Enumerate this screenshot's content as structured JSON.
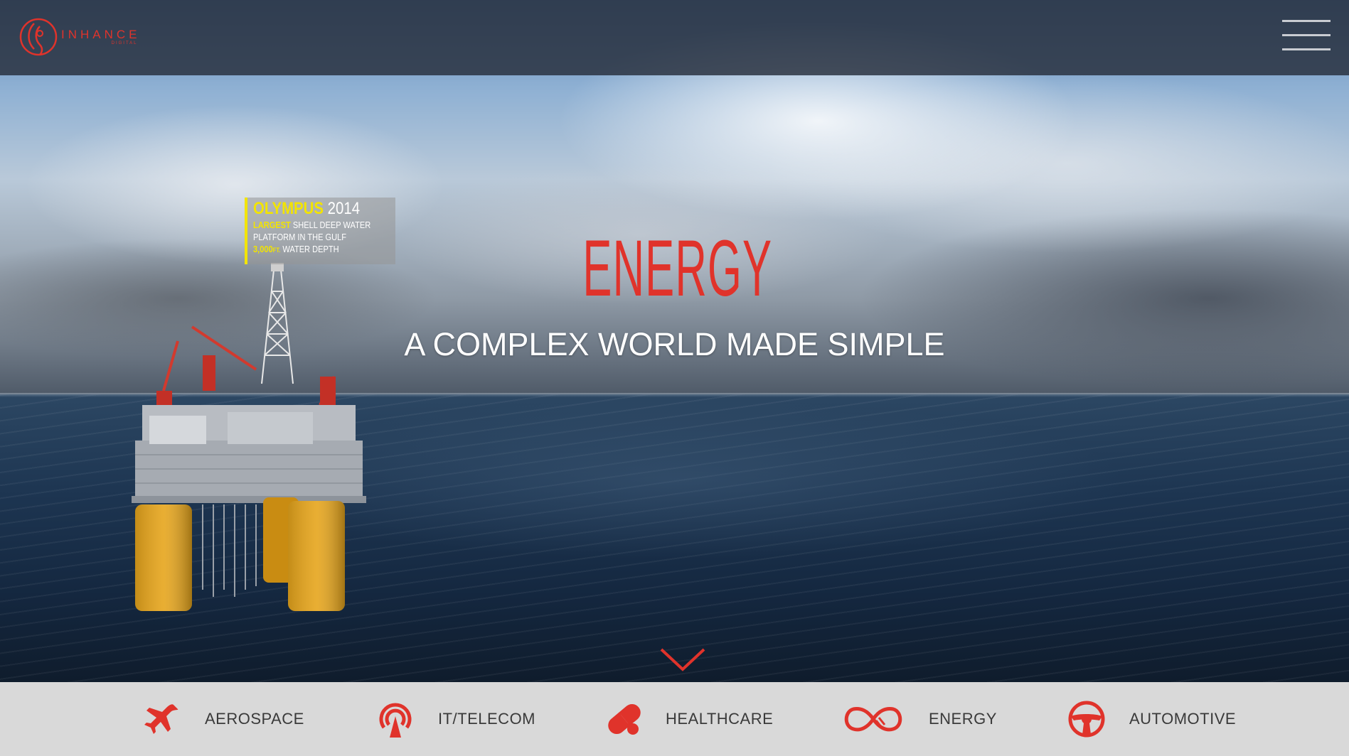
{
  "header": {
    "logo_name": "INHANCE",
    "logo_sub": "DIGITAL",
    "menu_icon": "hamburger-menu-icon"
  },
  "hero": {
    "title": "ENERGY",
    "subtitle": "A COMPLEX WORLD MADE SIMPLE",
    "scroll_icon": "chevron-down-icon"
  },
  "callout": {
    "name": "OLYMPUS",
    "year": "2014",
    "line2_highlight": "LARGEST",
    "line2_rest": "SHELL DEEP WATER",
    "line3": "PLATFORM IN THE GULF",
    "line4_highlight": "3,000",
    "line4_unit": "FT.",
    "line4_rest": "WATER DEPTH"
  },
  "bottom_nav": {
    "items": [
      {
        "label": "AEROSPACE",
        "icon": "airplane-icon"
      },
      {
        "label": "IT/TELECOM",
        "icon": "broadcast-tower-icon"
      },
      {
        "label": "HEALTHCARE",
        "icon": "pill-capsule-icon"
      },
      {
        "label": "ENERGY",
        "icon": "infinity-plug-icon"
      },
      {
        "label": "AUTOMOTIVE",
        "icon": "steering-wheel-icon"
      }
    ]
  },
  "colors": {
    "accent": "#e0332b",
    "callout_highlight": "#f2e400",
    "nav_bg": "#d9d9d9",
    "header_bg": "#262d3a"
  }
}
